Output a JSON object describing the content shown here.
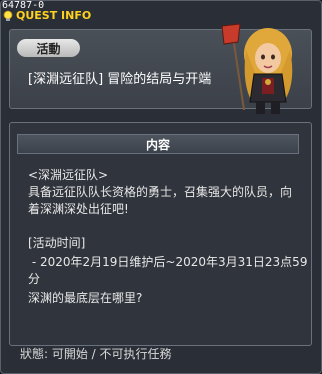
{
  "window": {
    "quest_id": "64787-0",
    "title": "QUEST INFO"
  },
  "quest": {
    "tag": "活動",
    "name": "[深淵远征队] 冒险的结局与开端"
  },
  "content": {
    "header": "内容",
    "lines": [
      "<深淵远征队>",
      "具备远征队队长资格的勇士，召集强大的队员，向",
      "着深渊深处出征吧!",
      "",
      "[活动时间]",
      " - 2020年2月19日维护后~2020年3月31日23点59分",
      "",
      "深渊的最底层在哪里?"
    ]
  },
  "status": {
    "text": "狀態: 可開始 / 不可执行任務"
  },
  "icons": {
    "title_icon": "lightbulb-icon",
    "npc": "npc-portrait"
  },
  "colors": {
    "title": "#ffd21e",
    "background": "#2a2e36"
  }
}
